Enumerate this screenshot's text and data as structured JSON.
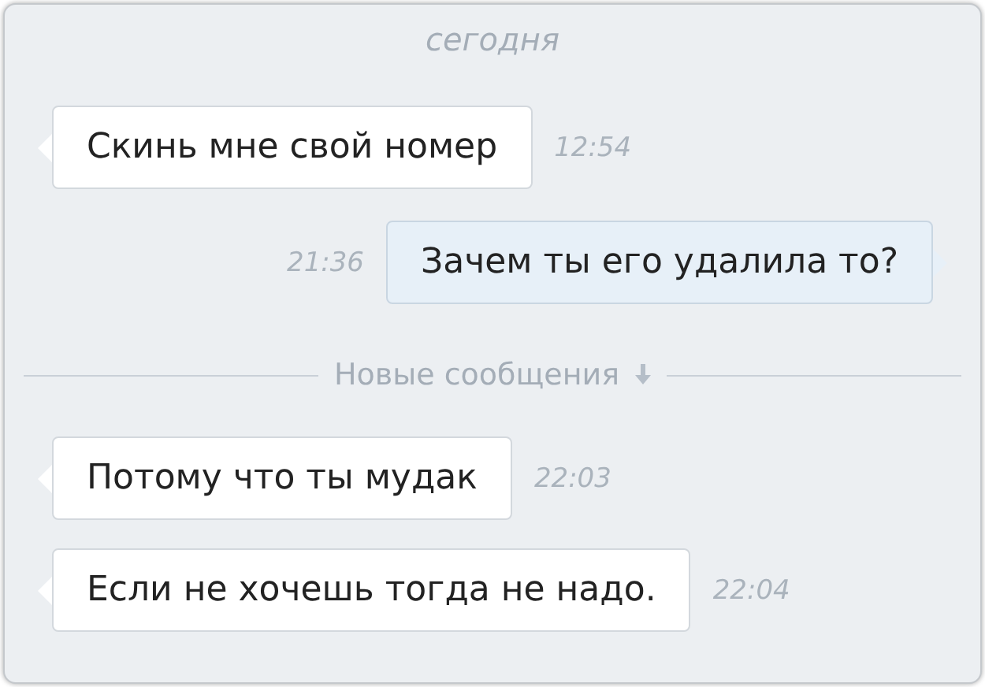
{
  "date_separator": "сегодня",
  "messages": [
    {
      "kind": "incoming",
      "text": "Скинь мне свой номер",
      "time": "12:54"
    },
    {
      "kind": "outgoing",
      "text": "Зачем ты его удалила то?",
      "time": "21:36"
    },
    {
      "kind": "divider",
      "text": "Новые сообщения"
    },
    {
      "kind": "incoming",
      "text": "Потому что ты мудак",
      "time": "22:03"
    },
    {
      "kind": "incoming",
      "text": "Если не хочешь тогда не надо.",
      "time": "22:04"
    }
  ]
}
